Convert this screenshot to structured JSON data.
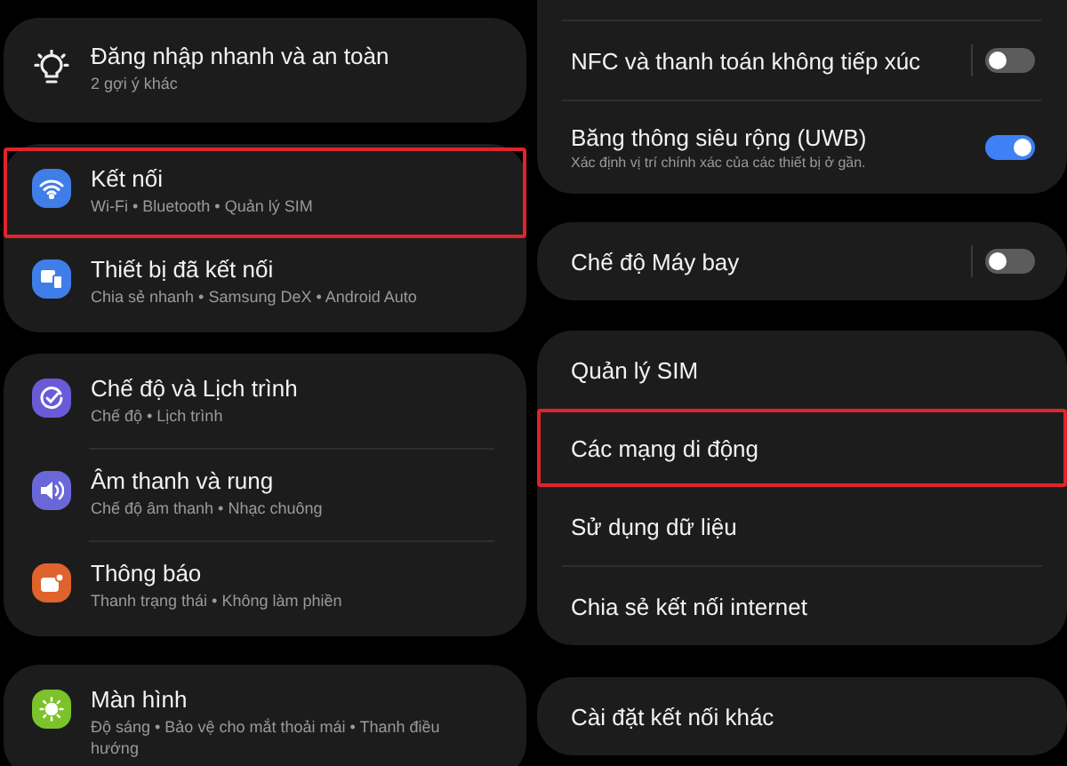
{
  "left_panel": {
    "groups": [
      {
        "items": [
          {
            "title": "Đăng nhập nhanh và an toàn",
            "subtitle": "2 gợi ý khác",
            "highlighted": false
          }
        ]
      },
      {
        "items": [
          {
            "title": "Kết nối",
            "subtitle": "Wi-Fi • Bluetooth • Quản lý SIM",
            "color": "#3f7ee8",
            "highlighted": true
          },
          {
            "title": "Thiết bị đã kết nối",
            "subtitle": "Chia sẻ nhanh • Samsung DeX • Android Auto",
            "color": "#3f7ee8",
            "highlighted": false
          }
        ]
      },
      {
        "items": [
          {
            "title": "Chế độ và Lịch trình",
            "subtitle": "Chế độ • Lịch trình",
            "color": "#6a5ad8",
            "highlighted": false
          },
          {
            "title": "Âm thanh và rung",
            "subtitle": "Chế độ âm thanh • Nhạc chuông",
            "color": "#6a68d8",
            "highlighted": false
          },
          {
            "title": "Thông báo",
            "subtitle": "Thanh trạng thái • Không làm phiền",
            "color": "#e0622c",
            "highlighted": false
          }
        ]
      },
      {
        "items": [
          {
            "title": "Màn hình",
            "subtitle": "Độ sáng • Bảo vệ cho mắt thoải mái • Thanh điều hướng",
            "color": "#7cc22a",
            "highlighted": false
          }
        ]
      }
    ]
  },
  "right_panel": {
    "groups": [
      {
        "items": [
          {
            "kind": "toggle",
            "title": "NFC và thanh toán không tiếp xúc",
            "on": false,
            "separator": true,
            "highlighted": false
          },
          {
            "kind": "toggle",
            "title": "Băng thông siêu rộng (UWB)",
            "subtitle": "Xác định vị trí chính xác của các thiết bị ở gần.",
            "on": true,
            "separator": false,
            "highlighted": false
          }
        ]
      },
      {
        "items": [
          {
            "kind": "toggle",
            "title": "Chế độ Máy bay",
            "on": false,
            "separator": true,
            "highlighted": false
          }
        ]
      },
      {
        "items": [
          {
            "kind": "link",
            "title": "Quản lý SIM",
            "highlighted": false
          },
          {
            "kind": "link",
            "title": "Các mạng di động",
            "highlighted": true
          },
          {
            "kind": "link",
            "title": "Sử dụng dữ liệu",
            "highlighted": false
          },
          {
            "kind": "link",
            "title": "Chia sẻ kết nối internet",
            "highlighted": false
          }
        ]
      },
      {
        "items": [
          {
            "kind": "link",
            "title": "Cài đặt kết nối khác",
            "highlighted": false
          }
        ]
      }
    ]
  }
}
